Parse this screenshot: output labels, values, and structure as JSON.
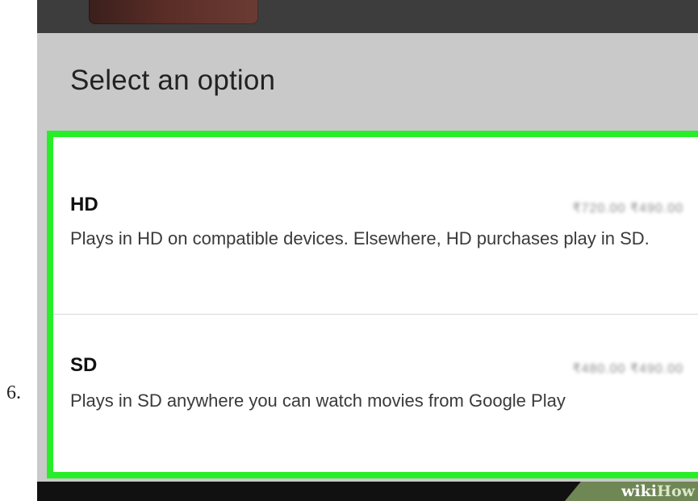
{
  "step": {
    "number": "6."
  },
  "dialog": {
    "title": "Select an option",
    "options": [
      {
        "name": "HD",
        "price": "₹720.00 ₹490.00",
        "description": "Plays in HD on compatible devices. Elsewhere, HD purchases play in SD."
      },
      {
        "name": "SD",
        "price": "₹480.00 ₹490.00",
        "description": "Plays in SD anywhere you can watch movies from Google Play"
      }
    ]
  },
  "watermark": {
    "part1": "wiki",
    "part2": "How"
  },
  "colors": {
    "highlight": "#28ee2a",
    "dialog_header": "#c9c9c9",
    "text": "#222222"
  }
}
